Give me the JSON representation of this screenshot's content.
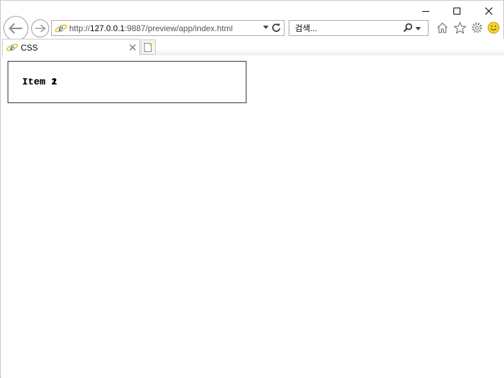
{
  "window": {
    "caption": {
      "minimize": "minimize",
      "maximize": "maximize",
      "close": "close"
    }
  },
  "browser": {
    "address": {
      "scheme": "http://",
      "host": "127.0.0.1",
      "rest": ":9887/preview/app/index.html"
    },
    "search": {
      "placeholder": "검색..."
    },
    "tabs": [
      {
        "title": "CSS"
      }
    ]
  },
  "page": {
    "items": [
      {
        "label": "Item 1"
      },
      {
        "label": "Item 2"
      }
    ]
  },
  "colors": {
    "ie_blue": "#1e7fd6",
    "ie_gold": "#f4b400",
    "smile": "#f6d32d"
  }
}
